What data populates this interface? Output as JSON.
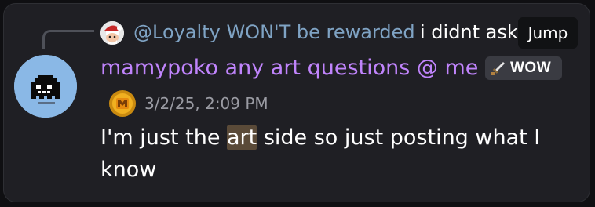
{
  "reply": {
    "author": "@Loyalty WON'T be rewarded",
    "text": "i didnt ask",
    "avatar_icon": "santa-cartoon-avatar"
  },
  "jump_button": {
    "label": "Jump"
  },
  "message": {
    "avatar_icon": "pixel-ghost-avatar",
    "author": "mamypoko any art questions @ me",
    "tag": {
      "icon": "sword-icon",
      "label": "WOW"
    },
    "badge_icon": "gold-coin-badge",
    "timestamp": "3/2/25, 2:09 PM",
    "text_before": "I'm just the ",
    "highlight": "art",
    "text_after": " side so just posting what I know"
  },
  "colors": {
    "background": "#1f1f24",
    "reply_author": "#7fa3c4",
    "username": "#c084fc",
    "timestamp": "#9a9ba3",
    "highlight": "#5a4a38"
  }
}
